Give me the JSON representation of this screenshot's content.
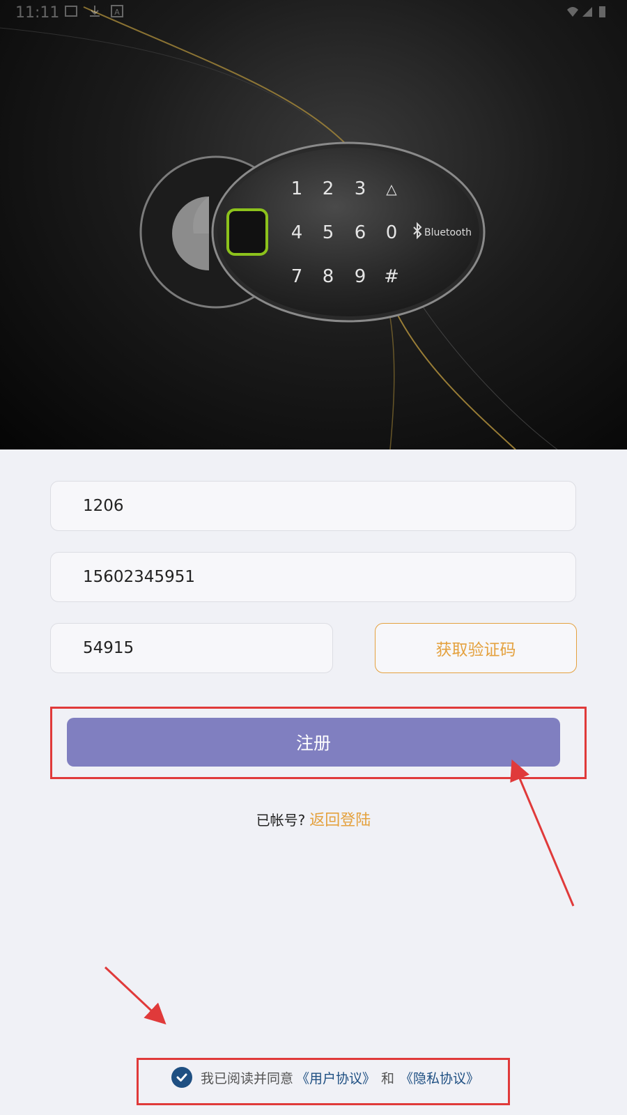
{
  "status_bar": {
    "time": "11:11",
    "icons": [
      "image-icon",
      "download-icon",
      "font-icon",
      "wifi-icon",
      "signal-icon",
      "battery-icon"
    ]
  },
  "hero": {
    "keypad_keys": [
      "1",
      "2",
      "3",
      "△",
      "4",
      "5",
      "6",
      "0",
      "7",
      "8",
      "9",
      "#"
    ],
    "bluetooth_label": "Bluetooth"
  },
  "form": {
    "username_value": "1206",
    "phone_value": "15602345951",
    "code_value": "54915",
    "get_code_label": "获取验证码",
    "register_label": "注册"
  },
  "login": {
    "prompt": "已帐号?",
    "link": "返回登陆"
  },
  "agreement": {
    "checked": true,
    "text": "我已阅读并同意",
    "user_agreement": "《用户协议》",
    "and": "和",
    "privacy_agreement": "《隐私协议》"
  },
  "colors": {
    "accent_orange": "#e4a13e",
    "register_purple": "#807fc0",
    "check_blue": "#1e4f82",
    "annotation_red": "#e03a3a",
    "page_bg": "#f0f1f6"
  }
}
